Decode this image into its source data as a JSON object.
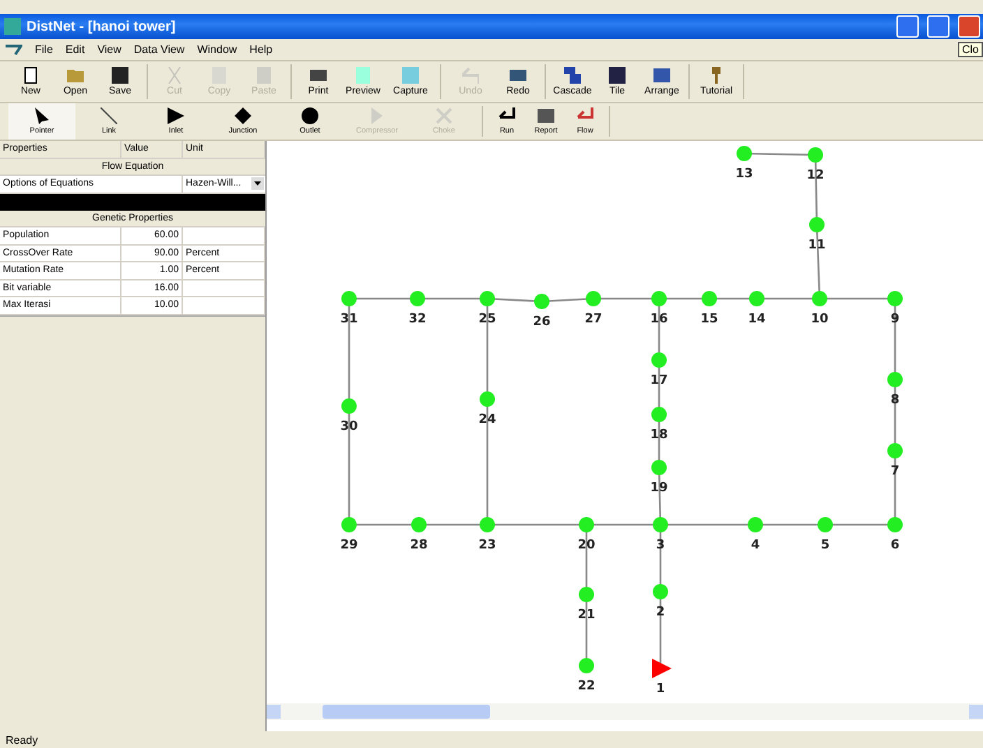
{
  "window": {
    "title": "DistNet  - [hanoi tower]",
    "tooltip": "Clo"
  },
  "menu": [
    "File",
    "Edit",
    "View",
    "Data View",
    "Window",
    "Help"
  ],
  "toolbar": [
    {
      "label": "New",
      "disabled": false
    },
    {
      "label": "Open",
      "disabled": false
    },
    {
      "label": "Save",
      "disabled": false
    },
    {
      "label": "Cut",
      "disabled": true
    },
    {
      "label": "Copy",
      "disabled": true
    },
    {
      "label": "Paste",
      "disabled": true
    },
    {
      "label": "Print",
      "disabled": false
    },
    {
      "label": "Preview",
      "disabled": false
    },
    {
      "label": "Capture",
      "disabled": false
    },
    {
      "label": "Undo",
      "disabled": true
    },
    {
      "label": "Redo",
      "disabled": false
    },
    {
      "label": "Cascade",
      "disabled": false
    },
    {
      "label": "Tile",
      "disabled": false
    },
    {
      "label": "Arrange",
      "disabled": false
    },
    {
      "label": "Tutorial",
      "disabled": false
    }
  ],
  "tools": [
    {
      "label": "Pointer",
      "selected": true,
      "disabled": false
    },
    {
      "label": "Link",
      "selected": false,
      "disabled": false
    },
    {
      "label": "Inlet",
      "selected": false,
      "disabled": false
    },
    {
      "label": "Junction",
      "selected": false,
      "disabled": false
    },
    {
      "label": "Outlet",
      "selected": false,
      "disabled": false
    },
    {
      "label": "Compressor",
      "selected": false,
      "disabled": true
    },
    {
      "label": "Choke",
      "selected": false,
      "disabled": true
    },
    {
      "label": "Run",
      "selected": false,
      "disabled": false
    },
    {
      "label": "Report",
      "selected": false,
      "disabled": false
    },
    {
      "label": "Flow",
      "selected": false,
      "disabled": false
    }
  ],
  "properties": {
    "columns": [
      "Properties",
      "Value",
      "Unit"
    ],
    "rows": [
      {
        "kind": "section",
        "label": "Flow Equation"
      },
      {
        "kind": "dropdown",
        "name": "Options of Equations",
        "unit": "Hazen-Will..."
      },
      {
        "kind": "bar"
      },
      {
        "kind": "section",
        "label": "Genetic Properties"
      },
      {
        "kind": "row",
        "name": "Population",
        "value": "60.00",
        "unit": ""
      },
      {
        "kind": "row",
        "name": "CrossOver Rate",
        "value": "90.00",
        "unit": "Percent"
      },
      {
        "kind": "row",
        "name": "Mutation Rate",
        "value": "1.00",
        "unit": "Percent"
      },
      {
        "kind": "row",
        "name": "Bit variable",
        "value": "16.00",
        "unit": ""
      },
      {
        "kind": "row",
        "name": "Max Iterasi",
        "value": "10.00",
        "unit": ""
      }
    ]
  },
  "network": {
    "nodes": [
      {
        "label": "13",
        "kind": "junction"
      },
      {
        "label": "12",
        "kind": "junction"
      },
      {
        "label": "11",
        "kind": "junction"
      },
      {
        "label": "31",
        "kind": "junction"
      },
      {
        "label": "32",
        "kind": "junction"
      },
      {
        "label": "25",
        "kind": "junction"
      },
      {
        "label": "26",
        "kind": "junction"
      },
      {
        "label": "27",
        "kind": "junction"
      },
      {
        "label": "16",
        "kind": "junction"
      },
      {
        "label": "15",
        "kind": "junction"
      },
      {
        "label": "14",
        "kind": "junction"
      },
      {
        "label": "10",
        "kind": "junction"
      },
      {
        "label": "9",
        "kind": "junction"
      },
      {
        "label": "17",
        "kind": "junction"
      },
      {
        "label": "8",
        "kind": "junction"
      },
      {
        "label": "24",
        "kind": "junction"
      },
      {
        "label": "30",
        "kind": "junction"
      },
      {
        "label": "18",
        "kind": "junction"
      },
      {
        "label": "7",
        "kind": "junction"
      },
      {
        "label": "19",
        "kind": "junction"
      },
      {
        "label": "29",
        "kind": "junction"
      },
      {
        "label": "28",
        "kind": "junction"
      },
      {
        "label": "23",
        "kind": "junction"
      },
      {
        "label": "20",
        "kind": "junction"
      },
      {
        "label": "3",
        "kind": "junction"
      },
      {
        "label": "4",
        "kind": "junction"
      },
      {
        "label": "5",
        "kind": "junction"
      },
      {
        "label": "6",
        "kind": "junction"
      },
      {
        "label": "2",
        "kind": "junction"
      },
      {
        "label": "21",
        "kind": "junction"
      },
      {
        "label": "22",
        "kind": "junction"
      },
      {
        "label": "1",
        "kind": "inlet"
      }
    ]
  },
  "status_bar": "Ready"
}
